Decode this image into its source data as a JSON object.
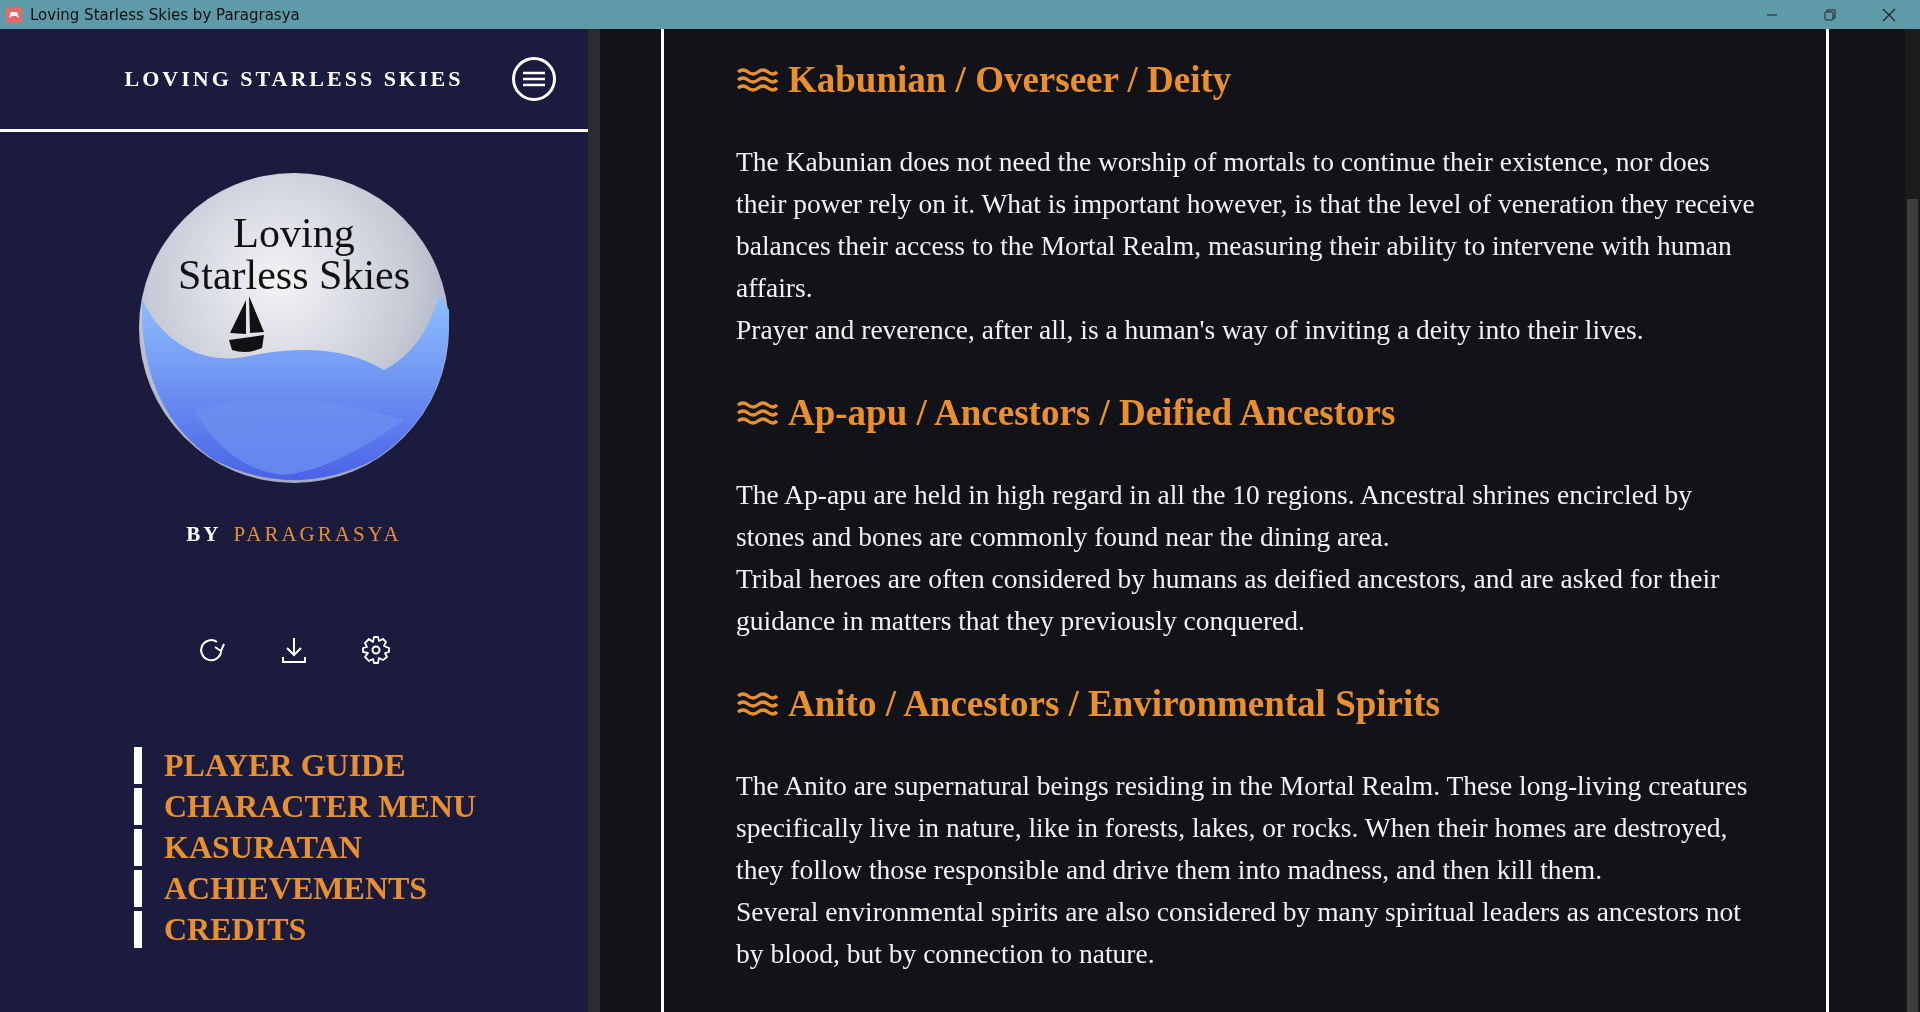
{
  "window": {
    "title": "Loving Starless Skies by Paragrasya"
  },
  "sidebar": {
    "title": "LOVING STARLESS SKIES",
    "logo": {
      "lines": [
        "Loving",
        "Starless Skies"
      ]
    },
    "byline": {
      "prefix": "BY",
      "author": "PARAGRASYA"
    },
    "nav": [
      {
        "label": "PLAYER GUIDE"
      },
      {
        "label": "CHARACTER MENU"
      },
      {
        "label": "KASURATAN"
      },
      {
        "label": "ACHIEVEMENTS"
      },
      {
        "label": "CREDITS"
      }
    ]
  },
  "sections": [
    {
      "heading": "Kabunian / Overseer / Deity",
      "paragraphs": [
        "The Kabunian does not need the worship of mortals to continue their existence, nor does their power rely on it. What is important however, is that the level of veneration they receive balances their access to the Mortal Realm, measuring their ability to intervene with human affairs.",
        "Prayer and reverence, after all, is a human's way of inviting a deity into their lives."
      ]
    },
    {
      "heading": "Ap-apu / Ancestors / Deified Ancestors",
      "paragraphs": [
        "The Ap-apu are held in high regard in all the 10 regions. Ancestral shrines encircled by stones and bones are commonly found near the dining area.",
        "Tribal heroes are often considered by humans as deified ancestors, and are asked for their guidance in matters that they previously conquered."
      ]
    },
    {
      "heading": "Anito / Ancestors / Environmental Spirits",
      "paragraphs": [
        "The Anito are supernatural beings residing in the Mortal Realm. These long-living creatures specifically live in nature, like in forests, lakes, or rocks. When their homes are destroyed, they follow those responsible and drive them into madness, and then kill them.",
        "Several environmental spirits are also considered by many spiritual leaders as ancestors not by blood, but by connection to nature."
      ]
    }
  ]
}
